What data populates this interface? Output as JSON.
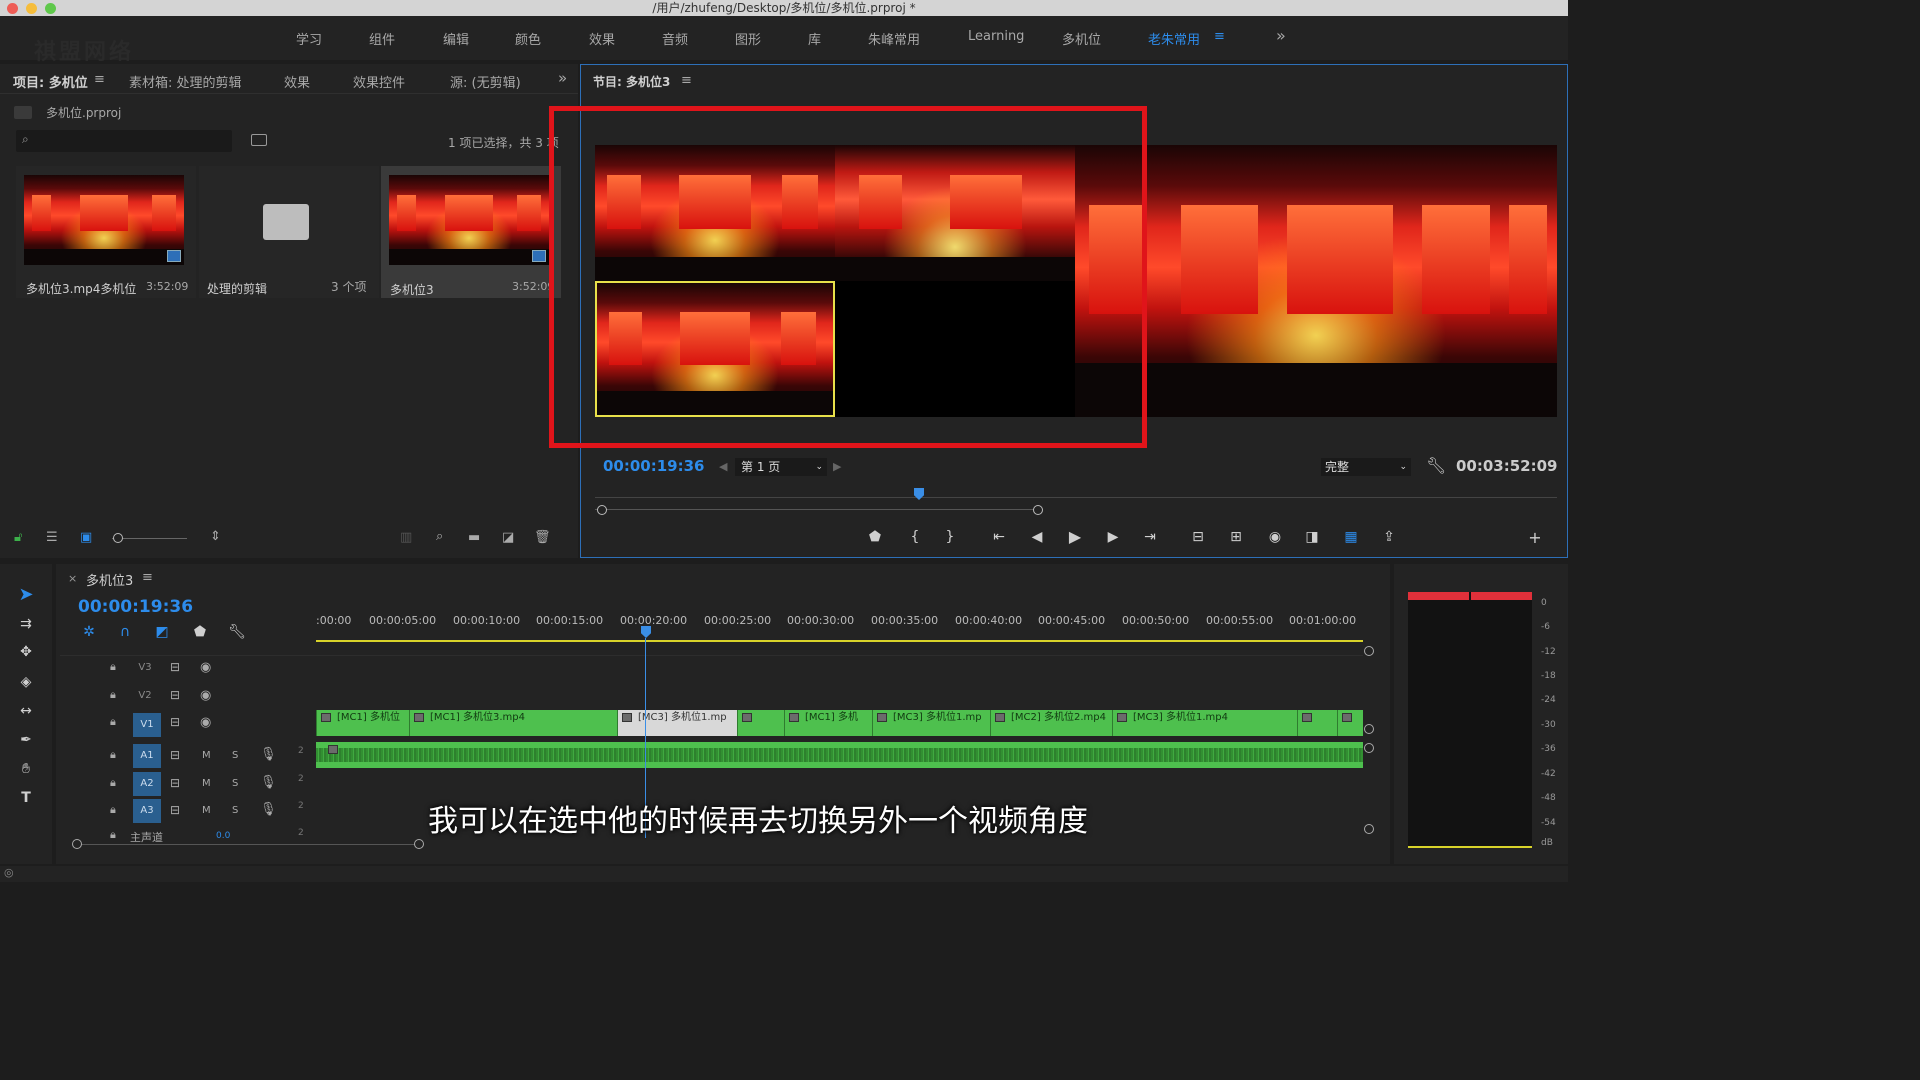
{
  "window": {
    "title": "/用户/zhufeng/Desktop/多机位/多机位.prproj *"
  },
  "watermark": "祺盟网络",
  "workspaces": [
    "学习",
    "组件",
    "编辑",
    "颜色",
    "效果",
    "音频",
    "图形",
    "库",
    "朱峰常用",
    "Learning",
    "多机位",
    "老朱常用"
  ],
  "workspace_menu_icon": "≡",
  "workspace_more": "»",
  "project_panel": {
    "tabs": [
      "项目: 多机位",
      "素材箱: 处理的剪辑",
      "效果",
      "效果控件",
      "源: (无剪辑)"
    ],
    "menu_icon": "≡",
    "overflow": "»",
    "project_file": "多机位.prproj",
    "search_placeholder": "",
    "selection_info": "1 项已选择，共 3 项",
    "items": [
      {
        "name": "多机位3.mp4多机位",
        "meta": "3:52:09"
      },
      {
        "name": "处理的剪辑",
        "meta": "3 个项"
      },
      {
        "name": "多机位3",
        "meta": "3:52:09"
      }
    ]
  },
  "program_monitor": {
    "title": "节目: 多机位3",
    "menu_icon": "≡",
    "timecode": "00:00:19:36",
    "page_select": "第 1 页",
    "quality": "完整",
    "duration": "00:03:52:09"
  },
  "timeline": {
    "sequence_name": "多机位3",
    "close": "×",
    "menu_icon": "≡",
    "timecode": "00:00:19:36",
    "ruler": [
      ":00:00",
      "00:00:05:00",
      "00:00:10:00",
      "00:00:15:00",
      "00:00:20:00",
      "00:00:25:00",
      "00:00:30:00",
      "00:00:35:00",
      "00:00:40:00",
      "00:00:45:00",
      "00:00:50:00",
      "00:00:55:00",
      "00:01:00:00"
    ],
    "video_tracks": [
      "V3",
      "V2",
      "V1"
    ],
    "audio_tracks": [
      "A1",
      "A2",
      "A3"
    ],
    "audio_toggles": {
      "mute": "M",
      "solo": "S"
    },
    "channel_num": "2",
    "master_label": "主声道",
    "master_value": "0.0",
    "master_num": "2",
    "clips": [
      {
        "label": "[MC1] 多机位"
      },
      {
        "label": "[MC1] 多机位3.mp4"
      },
      {
        "label": "[MC3] 多机位1.mp"
      },
      {
        "label": ""
      },
      {
        "label": "[MC1] 多机"
      },
      {
        "label": "[MC3] 多机位1.mp"
      },
      {
        "label": "[MC2] 多机位2.mp4"
      },
      {
        "label": "[MC3] 多机位1.mp4"
      },
      {
        "label": ""
      },
      {
        "label": ""
      }
    ]
  },
  "audio_meter": {
    "labels": [
      "0",
      "-6",
      "-12",
      "-18",
      "-24",
      "-30",
      "-36",
      "-42",
      "-48",
      "-54",
      "dB"
    ]
  },
  "subtitle": "我可以在选中他的时候再去切换另外一个视频角度",
  "colors": {
    "accent": "#2d8ceb",
    "highlight_box": "#e0141a",
    "clip_green": "#4ec04e",
    "playhead": "#3a8ee6"
  }
}
